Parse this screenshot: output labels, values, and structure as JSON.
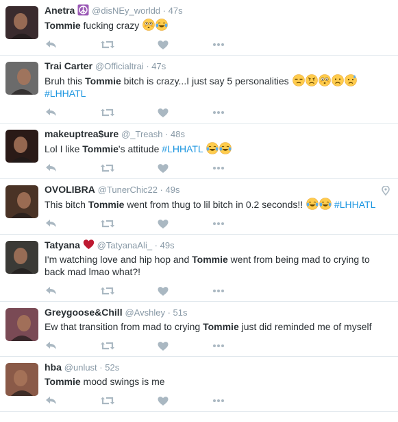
{
  "tweets": [
    {
      "fullname": "Anetra",
      "badge": "peace-symbol-icon",
      "screen_name": "@disNEy_worldd",
      "time": "47s",
      "text_parts": [
        {
          "t": "Tommie",
          "bold": true
        },
        {
          "t": " fucking crazy "
        }
      ],
      "emojis": [
        "flushed-face-icon",
        "tears-of-joy-icon"
      ],
      "avatar_color": "#3a2b2e"
    },
    {
      "fullname": "Trai Carter",
      "screen_name": "@Officialtrai",
      "time": "47s",
      "text_parts": [
        {
          "t": "Bruh this "
        },
        {
          "t": "Tommie",
          "bold": true
        },
        {
          "t": " bitch is crazy...I just say 5 personalities "
        }
      ],
      "emojis": [
        "unamused-face-icon",
        "angry-face-icon",
        "flushed-face-icon",
        "frowning-face-icon",
        "sad-sweat-face-icon"
      ],
      "hashtag": "#LHHATL",
      "avatar_color": "#6b6b6b"
    },
    {
      "fullname": "makeuptrea$ure",
      "screen_name": "@_Treash",
      "time": "48s",
      "text_parts": [
        {
          "t": "Lol I like "
        },
        {
          "t": "Tommie",
          "bold": true
        },
        {
          "t": "'s attitude "
        }
      ],
      "hashtag_inline": "#LHHATL",
      "emojis_after": [
        "tears-of-joy-icon",
        "tears-of-joy-icon"
      ],
      "avatar_color": "#2a1a17"
    },
    {
      "fullname": "OVOLIBRA",
      "screen_name": "@TunerChic22",
      "time": "49s",
      "geo": "location-pin-icon",
      "text_parts": [
        {
          "t": "This bitch "
        },
        {
          "t": "Tommie",
          "bold": true
        },
        {
          "t": " went from thug to lil bitch in 0.2 seconds!! "
        }
      ],
      "emojis": [
        "tears-of-joy-icon",
        "tears-of-joy-icon"
      ],
      "hashtag_inline": "#LHHATL",
      "avatar_color": "#4a3326"
    },
    {
      "fullname": "Tatyana",
      "badge": "red-heart-icon",
      "screen_name": "@TatyanaAli_",
      "time": "49s",
      "text_parts": [
        {
          "t": "I'm watching love and hip hop and "
        },
        {
          "t": "Tommie",
          "bold": true
        },
        {
          "t": " went from being mad to crying to back mad lmao what?!"
        }
      ],
      "avatar_color": "#3b3a36"
    },
    {
      "fullname": "Greygoose&Chill",
      "screen_name": "@Avshley",
      "time": "51s",
      "text_parts": [
        {
          "t": "Ew that transition from mad to crying "
        },
        {
          "t": "Tommie",
          "bold": true
        },
        {
          "t": " just did reminded me of myself"
        }
      ],
      "avatar_color": "#7a4a55"
    },
    {
      "fullname": "hba",
      "screen_name": "@unlust",
      "time": "52s",
      "text_parts": [
        {
          "t": "Tommie",
          "bold": true
        },
        {
          "t": " mood swings is me"
        }
      ],
      "avatar_color": "#8a5a48"
    }
  ],
  "actions": [
    "reply-icon",
    "retweet-icon",
    "like-icon",
    "more-icon"
  ],
  "colors": {
    "hashtag": "#1b95e0",
    "meta": "#8899a6",
    "action_icon": "#aab8c2",
    "divider": "#e1e8ed"
  }
}
